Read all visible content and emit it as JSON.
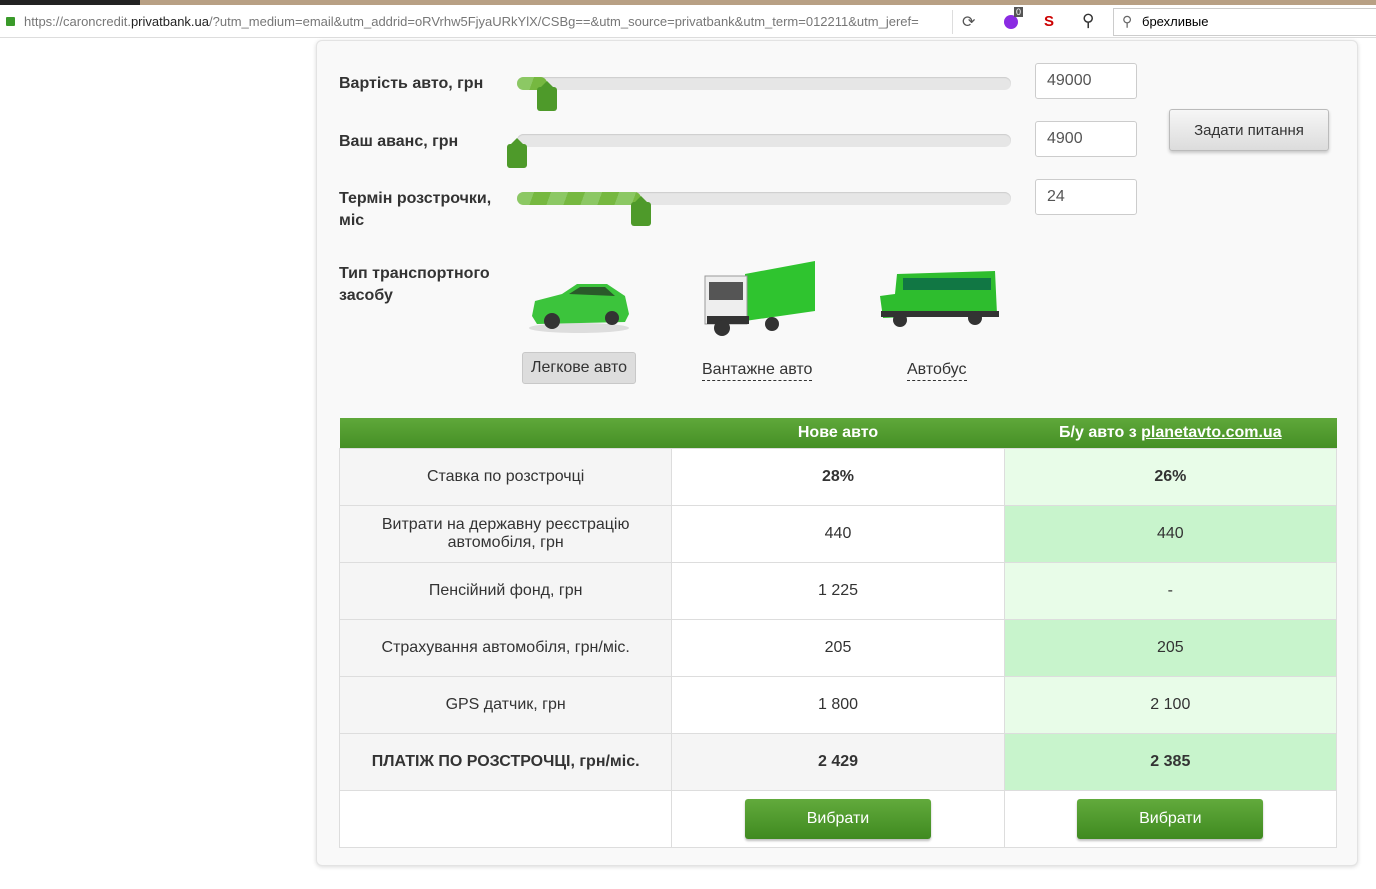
{
  "browser": {
    "url_prefix": "https://caroncredit.",
    "url_domain": "privatbank.ua",
    "url_rest": "/?utm_medium=email&utm_addrid=oRVrhw5FjyaURkYlX/CSBg==&utm_source=privatbank&utm_term=012211&utm_jeref=",
    "ext_badge": "0",
    "search_value": "брехливые"
  },
  "form": {
    "sliders": [
      {
        "label": "Вартість авто, грн",
        "value": "49000",
        "fill_fraction": 0.06
      },
      {
        "label": "Ваш аванс, грн",
        "value": "4900",
        "fill_fraction": 0.0
      },
      {
        "label": "Термін розстрочки, міс",
        "value": "24",
        "fill_fraction": 0.25
      }
    ],
    "ask_button": "Задати питання",
    "vehicle_label": "Тип транспортного засобу",
    "vehicles": [
      {
        "label": "Легкове авто",
        "selected": true
      },
      {
        "label": "Вантажне авто"
      },
      {
        "label": "Автобус"
      }
    ]
  },
  "table": {
    "headers": [
      "",
      "Нове авто",
      "Б/у авто з ",
      "planetavto.com.ua"
    ],
    "rows": [
      [
        "Ставка по розстрочці",
        "28%",
        "26%"
      ],
      [
        "Витрати на державну реєстрацію автомобіля, грн",
        "440",
        "440"
      ],
      [
        "Пенсійний фонд, грн",
        "1 225",
        "-"
      ],
      [
        "Страхування автомобіля, грн/міс.",
        "205",
        "205"
      ],
      [
        "GPS датчик, грн",
        "1 800",
        "2 100"
      ],
      [
        "ПЛАТІЖ ПО РОЗСТРОЧЦІ, грн/міс.",
        "2 429",
        "2 385"
      ]
    ],
    "choose": "Вибрати"
  },
  "colors": {
    "green": "#4e9a2a",
    "light_green": "#e8fce8",
    "mid_green": "#c8f4cc"
  }
}
